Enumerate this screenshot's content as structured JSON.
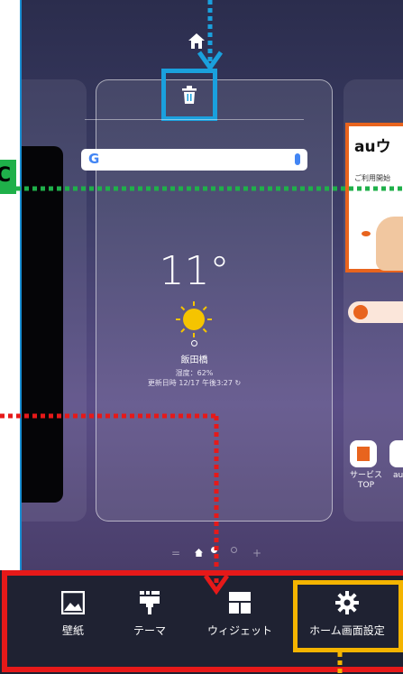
{
  "weather": {
    "temperature": "11°",
    "location": "飯田橋",
    "humidity": "湿度：62%",
    "updated": "更新日時 12/17 午後3:27"
  },
  "search_bar": {
    "logo": "G"
  },
  "right_page": {
    "au_title": "auウ",
    "au_subtitle": "ご利用開始",
    "shortcut_label_1": "サービス TOP",
    "shortcut_label_2": "au"
  },
  "callout": {
    "marker_letter": "C"
  },
  "toolbar": {
    "items": [
      {
        "label": "壁紙",
        "icon": "image-icon"
      },
      {
        "label": "テーマ",
        "icon": "brush-icon"
      },
      {
        "label": "ウィジェット",
        "icon": "widgets-icon"
      },
      {
        "label": "ホーム画面設定",
        "icon": "gear-icon"
      }
    ]
  },
  "page_indicator": {
    "left_symbol": "=",
    "right_symbol": "+"
  },
  "colors": {
    "blue_highlight": "#1aa0dd",
    "green_highlight": "#1fb04a",
    "red_highlight": "#e61919",
    "yellow_highlight": "#f4b400",
    "au_orange": "#e8641e"
  }
}
